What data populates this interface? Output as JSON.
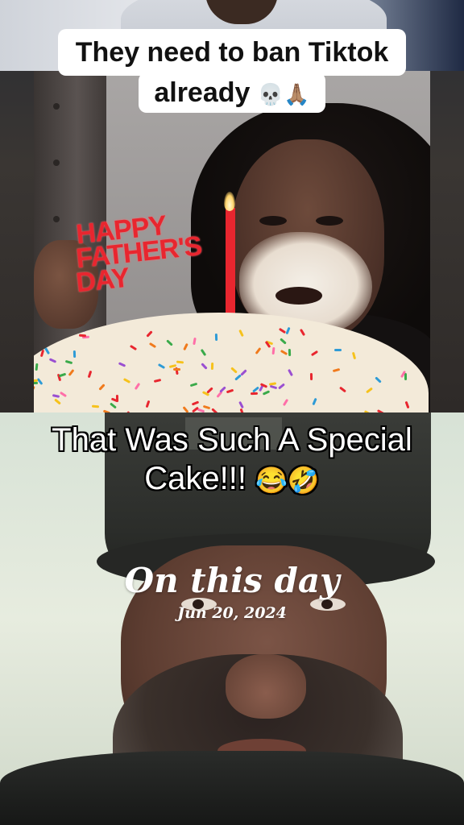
{
  "top_caption": {
    "line1": "They need to ban Tiktok",
    "line2_text": "already",
    "line2_emoji": "💀🙏🏽"
  },
  "cake_topper": {
    "line1": "HAPPY",
    "line2": "FATHER'S",
    "line3": "DAY"
  },
  "middle_caption": {
    "line1": "That Was Such A Special",
    "line2_text": "Cake!!!",
    "line2_emoji": "😂🤣"
  },
  "memory_overlay": {
    "title": "On this day",
    "date": "Jun 20, 2024"
  },
  "colors": {
    "caption_bg": "#ffffff",
    "caption_text": "#111111",
    "topper_red": "#e8262f",
    "overlay_text": "#ffffff"
  }
}
